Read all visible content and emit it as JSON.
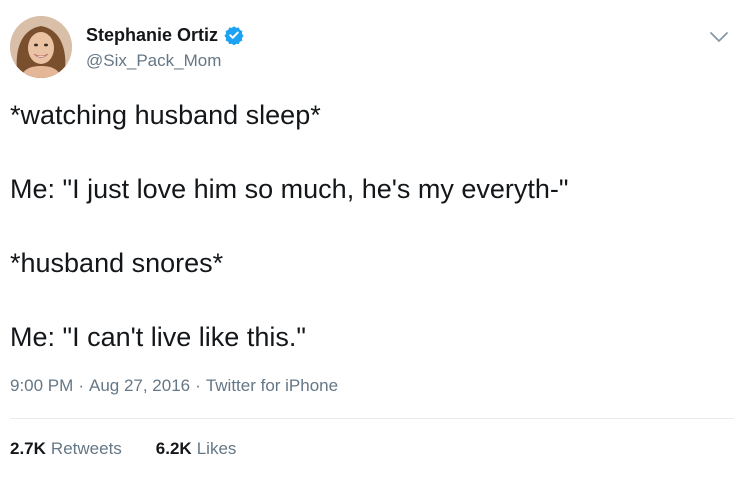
{
  "tweet": {
    "author": {
      "display_name": "Stephanie Ortiz",
      "handle": "@Six_Pack_Mom",
      "verified": true,
      "avatar_icon": "profile-photo"
    },
    "menu_icon": "chevron-down-icon",
    "body_lines": [
      "*watching husband sleep*",
      "Me: \"I just love him so much, he's my everyth-\"",
      "*husband snores*",
      "Me: \"I can't live like this.\""
    ],
    "meta": {
      "time": "9:00 PM",
      "date": "Aug 27, 2016",
      "source": "Twitter for iPhone",
      "separator": "·"
    },
    "stats": {
      "retweets_count": "2.7K",
      "retweets_label": "Retweets",
      "likes_count": "6.2K",
      "likes_label": "Likes"
    }
  },
  "colors": {
    "text_primary": "#14171a",
    "text_secondary": "#657786",
    "verified_badge": "#1da1f2",
    "divider": "#e6ecf0"
  }
}
